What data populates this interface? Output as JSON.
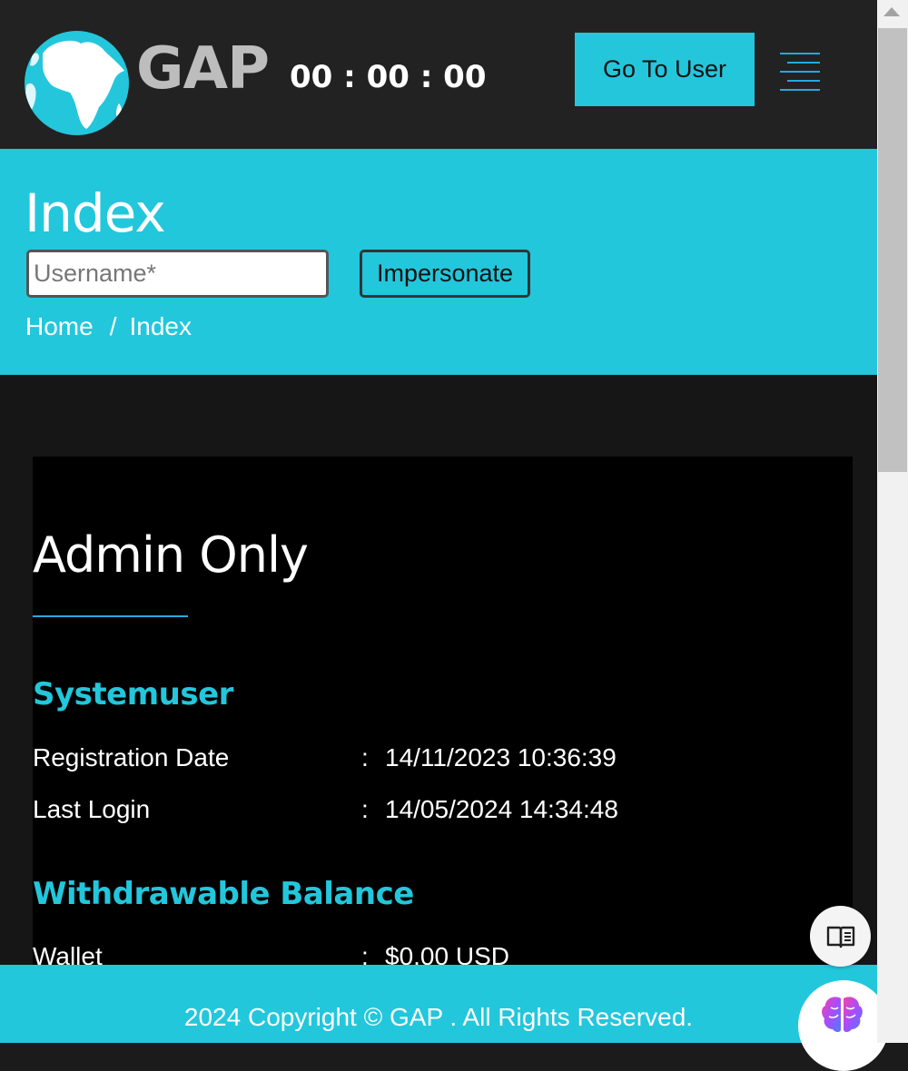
{
  "header": {
    "logo_text": "GAP",
    "timer": "00 : 00 : 00",
    "goto_button_label": "Go To User"
  },
  "banner": {
    "title": "Index",
    "username_placeholder": "Username*",
    "impersonate_label": "Impersonate",
    "breadcrumb": {
      "home": "Home",
      "separator": "/",
      "current": "Index"
    }
  },
  "card": {
    "title": "Admin Only",
    "user_section": {
      "heading": "Systemuser",
      "rows": [
        {
          "label": "Registration Date",
          "colon": ":",
          "value": "14/11/2023 10:36:39"
        },
        {
          "label": "Last Login",
          "colon": ":",
          "value": "14/05/2024 14:34:48"
        }
      ]
    },
    "balance_section": {
      "heading": "Withdrawable Balance",
      "rows": [
        {
          "label": "Wallet",
          "colon": ":",
          "value": "$0.00 USD"
        }
      ]
    }
  },
  "footer": {
    "text": "2024 Copyright © GAP . All Rights Reserved."
  },
  "colors": {
    "accent": "#22c7dc",
    "header_bg": "#222222",
    "card_bg": "#000000",
    "underline": "#29a9e0"
  },
  "icons": {
    "menu": "hamburger-menu-icon",
    "reader": "book-open-icon",
    "ai": "brain-icon",
    "logo": "africa-globe-icon"
  }
}
